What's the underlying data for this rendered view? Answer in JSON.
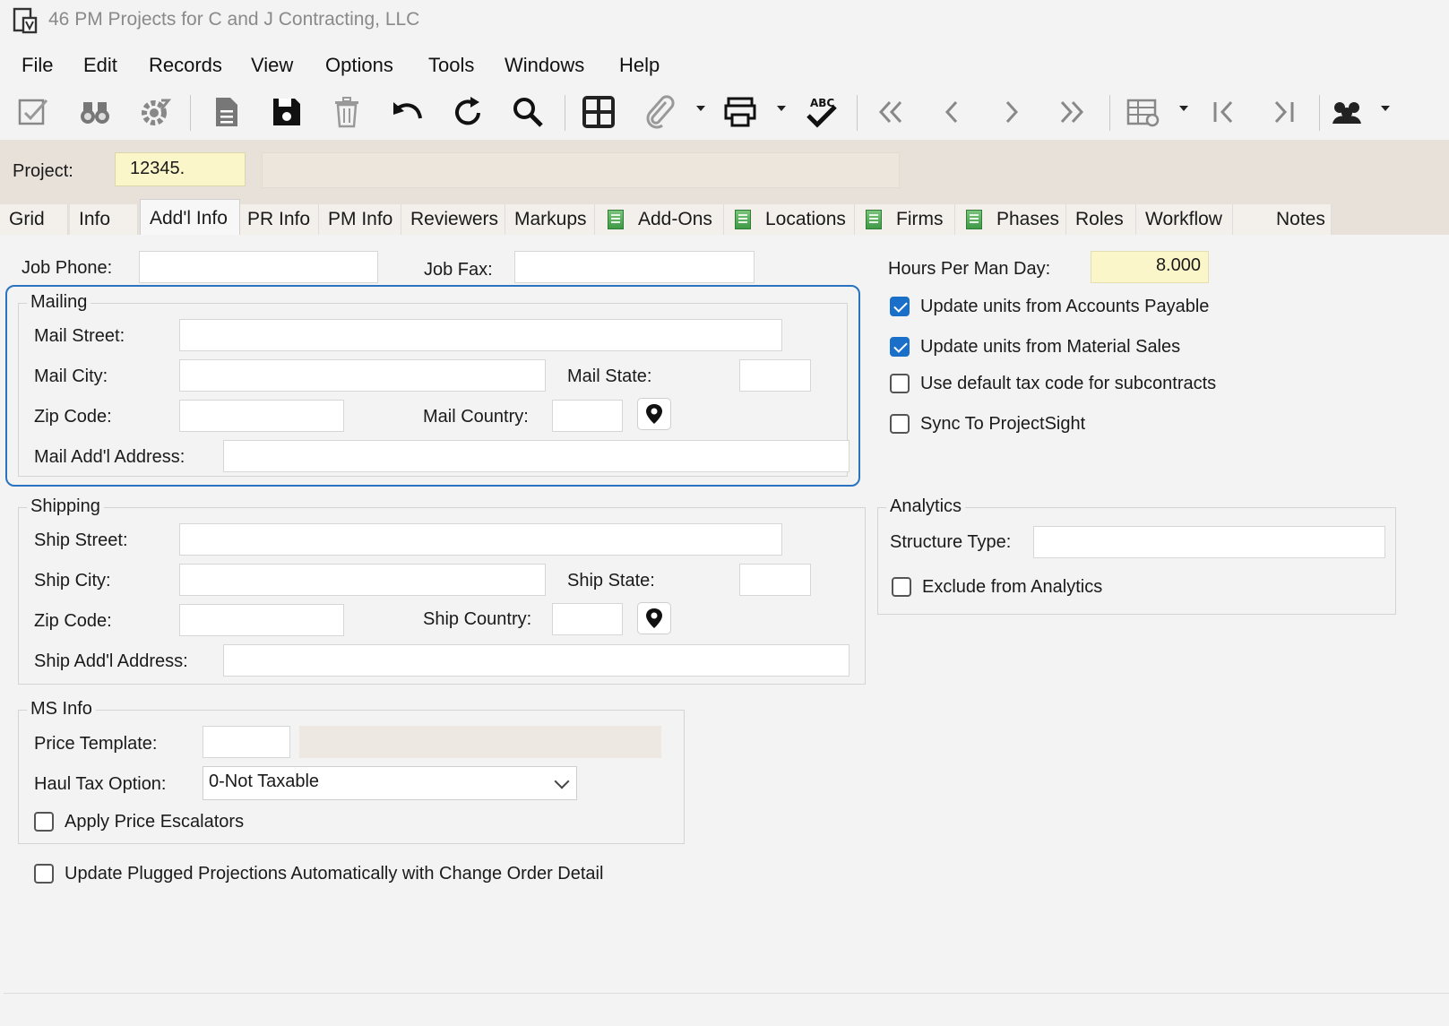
{
  "window": {
    "title": "46 PM Projects for C and J Contracting, LLC",
    "app_icon": "form-document-icon"
  },
  "menu": [
    "File",
    "Edit",
    "Records",
    "View",
    "Options",
    "Tools",
    "Windows",
    "Help"
  ],
  "toolbar_icons": [
    "edit-form-icon",
    "binoculars-icon",
    "settings-gear-icon",
    "new-document-icon",
    "save-icon",
    "delete-icon",
    "undo-icon",
    "refresh-icon",
    "search-icon",
    "grid-view-icon",
    "attach-icon",
    "print-icon",
    "spellcheck-icon",
    "first-record-icon",
    "previous-record-icon",
    "next-record-icon",
    "last-record-icon",
    "table-settings-icon",
    "jump-first-icon",
    "jump-last-icon",
    "users-icon"
  ],
  "project": {
    "label": "Project:",
    "value": "12345."
  },
  "tabs": [
    {
      "label": "Grid",
      "icon": false
    },
    {
      "label": "Info",
      "icon": false
    },
    {
      "label": "Add'l Info",
      "icon": false,
      "active": true
    },
    {
      "label": "PR Info",
      "icon": false
    },
    {
      "label": "PM Info",
      "icon": false
    },
    {
      "label": "Reviewers",
      "icon": false
    },
    {
      "label": "Markups",
      "icon": false
    },
    {
      "label": "Add-Ons",
      "icon": true
    },
    {
      "label": "Locations",
      "icon": true
    },
    {
      "label": "Firms",
      "icon": true
    },
    {
      "label": "Phases",
      "icon": true
    },
    {
      "label": "Roles",
      "icon": false
    },
    {
      "label": "Workflow",
      "icon": false
    },
    {
      "label": "Notes",
      "icon": false
    }
  ],
  "job": {
    "phone_label": "Job Phone:",
    "phone_value": "",
    "fax_label": "Job Fax:",
    "fax_value": ""
  },
  "mailing": {
    "title": "Mailing",
    "street_label": "Mail Street:",
    "street": "",
    "city_label": "Mail City:",
    "city": "",
    "state_label": "Mail State:",
    "state": "",
    "zip_label": "Zip Code:",
    "zip": "",
    "country_label": "Mail Country:",
    "country": "",
    "addl_label": "Mail Add'l Address:",
    "addl": ""
  },
  "shipping": {
    "title": "Shipping",
    "street_label": "Ship Street:",
    "street": "",
    "city_label": "Ship City:",
    "city": "",
    "state_label": "Ship State:",
    "state": "",
    "zip_label": "Zip Code:",
    "zip": "",
    "country_label": "Ship Country:",
    "country": "",
    "addl_label": "Ship Add'l Address:",
    "addl": ""
  },
  "ms_info": {
    "title": "MS Info",
    "price_template_label": "Price Template:",
    "price_template": "",
    "haul_tax_label": "Haul Tax Option:",
    "haul_tax_value": "0-Not Taxable",
    "apply_escalators_label": "Apply Price Escalators",
    "apply_escalators": false
  },
  "update_plugged_label": "Update Plugged Projections Automatically with Change Order Detail",
  "update_plugged": false,
  "right": {
    "hours_label": "Hours Per Man Day:",
    "hours_value": "8.000",
    "checks": [
      {
        "label": "Update units from Accounts Payable",
        "checked": true
      },
      {
        "label": "Update units from Material Sales",
        "checked": true
      },
      {
        "label": "Use default tax code for subcontracts",
        "checked": false
      },
      {
        "label": "Sync To ProjectSight",
        "checked": false
      }
    ]
  },
  "analytics": {
    "title": "Analytics",
    "structure_label": "Structure Type:",
    "structure_value": "",
    "exclude_label": "Exclude from Analytics",
    "exclude": false
  },
  "colors": {
    "accent": "#1a6fc9",
    "highlight": "#2a73c0",
    "header_bg": "#e8e1da",
    "required_field": "#fbf6c9"
  }
}
